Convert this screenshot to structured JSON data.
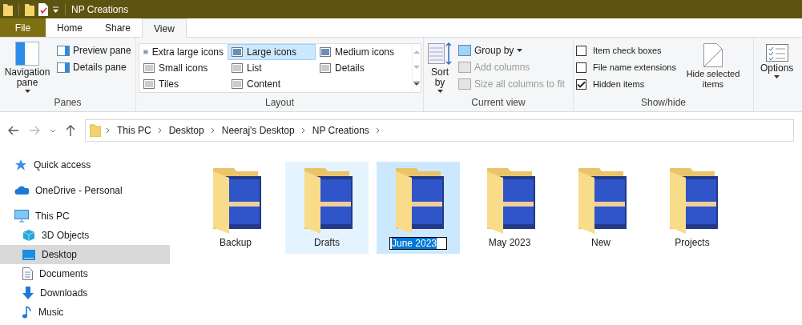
{
  "window": {
    "title": "NP Creations"
  },
  "tabs": [
    {
      "label": "File",
      "kind": "file",
      "selected": false
    },
    {
      "label": "Home",
      "kind": "tab",
      "selected": false
    },
    {
      "label": "Share",
      "kind": "tab",
      "selected": false
    },
    {
      "label": "View",
      "kind": "tab",
      "selected": true
    }
  ],
  "ribbon": {
    "panes": {
      "label": "Panes",
      "navigation_pane": "Navigation pane",
      "items": [
        "Preview pane",
        "Details pane"
      ]
    },
    "layout": {
      "label": "Layout",
      "options": [
        {
          "label": "Extra large icons",
          "selected": false
        },
        {
          "label": "Large icons",
          "selected": true
        },
        {
          "label": "Medium icons",
          "selected": false
        },
        {
          "label": "Small icons",
          "selected": false
        },
        {
          "label": "List",
          "selected": false
        },
        {
          "label": "Details",
          "selected": false
        },
        {
          "label": "Tiles",
          "selected": false
        },
        {
          "label": "Content",
          "selected": false
        }
      ]
    },
    "current_view": {
      "label": "Current view",
      "sort_by": "Sort by",
      "items": [
        {
          "label": "Group by",
          "disabled": false
        },
        {
          "label": "Add columns",
          "disabled": true
        },
        {
          "label": "Size all columns to fit",
          "disabled": true
        }
      ]
    },
    "show_hide": {
      "label": "Show/hide",
      "checkboxes": [
        {
          "label": "Item check boxes",
          "checked": false
        },
        {
          "label": "File name extensions",
          "checked": false
        },
        {
          "label": "Hidden items",
          "checked": true
        }
      ],
      "hide_selected": "Hide selected items"
    },
    "options": {
      "label": "Options"
    }
  },
  "address_bar": {
    "path": [
      "This PC",
      "Desktop",
      "Neeraj's Desktop",
      "NP Creations"
    ]
  },
  "sidebar": {
    "items": [
      {
        "label": "Quick access",
        "kind": "star",
        "selected": false
      },
      {
        "label": "OneDrive - Personal",
        "kind": "cloud",
        "selected": false
      },
      {
        "label": "This PC",
        "kind": "pc",
        "selected": false,
        "children": [
          {
            "label": "3D Objects",
            "kind": "cube",
            "selected": false
          },
          {
            "label": "Desktop",
            "kind": "desktop",
            "selected": true
          },
          {
            "label": "Documents",
            "kind": "document",
            "selected": false
          },
          {
            "label": "Downloads",
            "kind": "download",
            "selected": false
          },
          {
            "label": "Music",
            "kind": "music",
            "selected": false
          }
        ]
      }
    ]
  },
  "folders": [
    {
      "name": "Backup",
      "selected": false,
      "hovered": false,
      "renaming": false
    },
    {
      "name": "Drafts",
      "selected": false,
      "hovered": true,
      "renaming": false
    },
    {
      "name": "June 2023",
      "selected": true,
      "hovered": false,
      "renaming": true
    },
    {
      "name": "May 2023",
      "selected": false,
      "hovered": false,
      "renaming": false
    },
    {
      "name": "New",
      "selected": false,
      "hovered": false,
      "renaming": false
    },
    {
      "name": "Projects",
      "selected": false,
      "hovered": false,
      "renaming": false
    }
  ]
}
